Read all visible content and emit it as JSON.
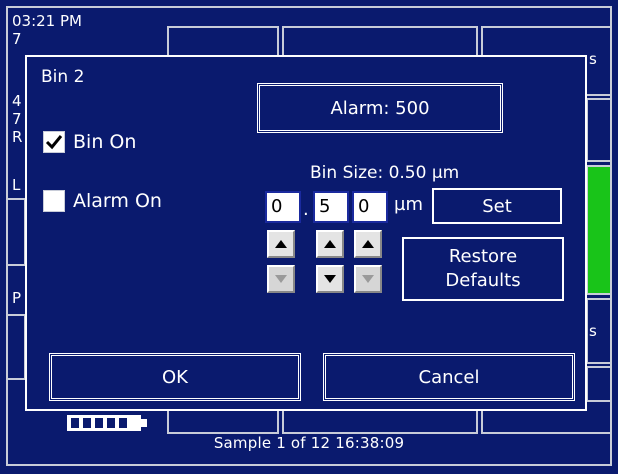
{
  "background": {
    "clock": "03:21 PM",
    "side_fragments": [
      "7",
      "4",
      "7",
      "R",
      "L",
      "P"
    ],
    "right_fragments": [
      "s",
      "s"
    ],
    "status_line": "Sample  1 of 12  16:38:09"
  },
  "dialog": {
    "title": "Bin 2",
    "alarm_button": "Alarm: 500",
    "bin_on": {
      "label": "Bin On",
      "checked": true
    },
    "alarm_on": {
      "label": "Alarm On",
      "checked": false
    },
    "bin_size_label": "Bin Size: 0.50 µm",
    "digits": [
      "0",
      "5",
      "0"
    ],
    "decimal_separator": ".",
    "unit": "µm",
    "set_button": "Set",
    "restore_line1": "Restore",
    "restore_line2": "Defaults",
    "ok_button": "OK",
    "cancel_button": "Cancel"
  },
  "colors": {
    "background": "#0a1a6e",
    "border": "#ffffff",
    "status_green": "#19c419"
  }
}
